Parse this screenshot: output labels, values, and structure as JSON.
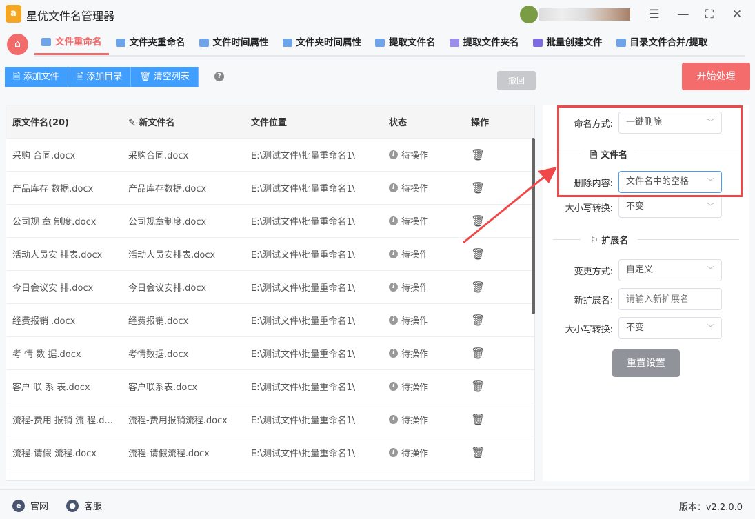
{
  "app": {
    "title": "星优文件名管理器",
    "logo_text": "b a"
  },
  "tabs": [
    {
      "label": "文件重命名",
      "active": true
    },
    {
      "label": "文件夹重命名"
    },
    {
      "label": "文件时间属性"
    },
    {
      "label": "文件夹时间属性"
    },
    {
      "label": "提取文件名"
    },
    {
      "label": "提取文件夹名"
    },
    {
      "label": "批量创建文件"
    },
    {
      "label": "目录文件合并/提取"
    }
  ],
  "toolbar": {
    "add_file": "添加文件",
    "add_dir": "添加目录",
    "clear": "清空列表",
    "help": "?",
    "undo": "撤回",
    "start": "开始处理"
  },
  "table": {
    "headers": [
      "原文件名(20)",
      "新文件名",
      "文件位置",
      "状态",
      "操作"
    ],
    "rows": [
      [
        "采购 合同.docx",
        "采购合同.docx",
        "E:\\测试文件\\批量重命名1\\",
        "待操作"
      ],
      [
        "产品库存 数据.docx",
        "产品库存数据.docx",
        "E:\\测试文件\\批量重命名1\\",
        "待操作"
      ],
      [
        "公司规 章 制度.docx",
        "公司规章制度.docx",
        "E:\\测试文件\\批量重命名1\\",
        "待操作"
      ],
      [
        "活动人员安 排表.docx",
        "活动人员安排表.docx",
        "E:\\测试文件\\批量重命名1\\",
        "待操作"
      ],
      [
        "今日会议安 排.docx",
        "今日会议安排.docx",
        "E:\\测试文件\\批量重命名1\\",
        "待操作"
      ],
      [
        "经费报销 .docx",
        "经费报销.docx",
        "E:\\测试文件\\批量重命名1\\",
        "待操作"
      ],
      [
        "考 情 数 据.docx",
        "考情数据.docx",
        "E:\\测试文件\\批量重命名1\\",
        "待操作"
      ],
      [
        "客户 联 系 表.docx",
        "客户联系表.docx",
        "E:\\测试文件\\批量重命名1\\",
        "待操作"
      ],
      [
        "流程-费用 报销 流 程.d...",
        "流程-费用报销流程.docx",
        "E:\\测试文件\\批量重命名1\\",
        "待操作"
      ],
      [
        "流程-请假 流程.docx",
        "流程-请假流程.docx",
        "E:\\测试文件\\批量重命名1\\",
        "待操作"
      ]
    ]
  },
  "panel": {
    "naming_label": "命名方式:",
    "naming_value": "一键删除",
    "filename_section": "文件名",
    "delete_label": "删除内容:",
    "delete_value": "文件名中的空格",
    "case_label": "大小写转换:",
    "case_value": "不变",
    "ext_section": "扩展名",
    "ext_mode_label": "变更方式:",
    "ext_mode_value": "自定义",
    "new_ext_label": "新扩展名:",
    "new_ext_placeholder": "请输入新扩展名",
    "ext_case_label": "大小写转换:",
    "ext_case_value": "不变",
    "reset": "重置设置"
  },
  "footer": {
    "website": "官网",
    "support": "客服",
    "version": "版本：v2.2.0.0"
  },
  "colors": {
    "accent": "#f56c6c",
    "primary": "#409eff",
    "highlight": "#f04848"
  }
}
